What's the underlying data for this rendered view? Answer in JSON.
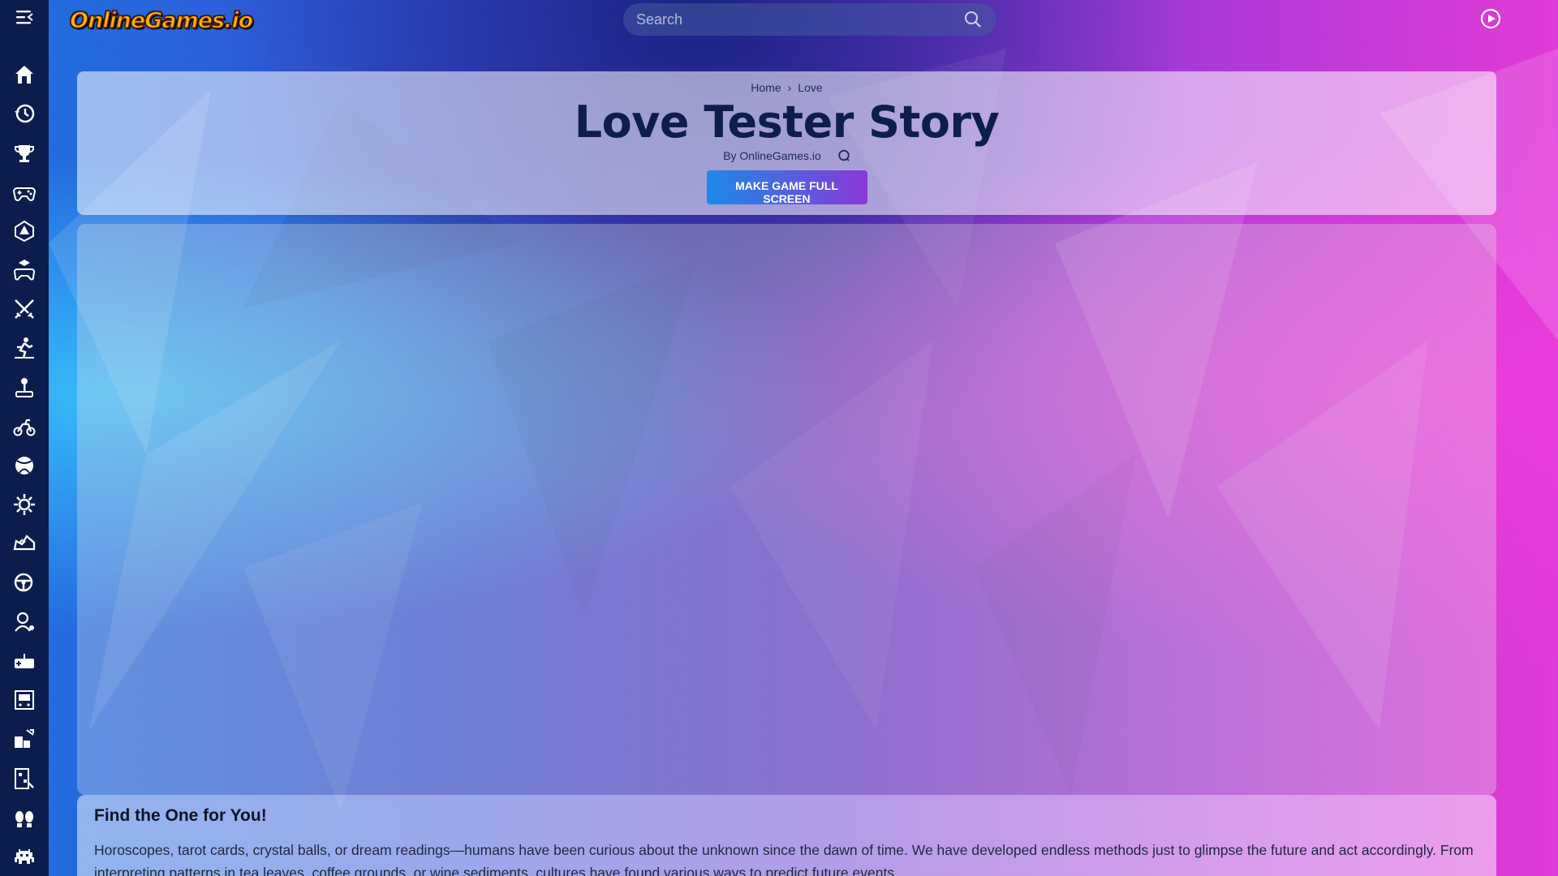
{
  "site": {
    "logo_text": "OnlineGames.io"
  },
  "search": {
    "placeholder": "Search"
  },
  "sidebar": {
    "items": [
      {
        "icon": "home-icon"
      },
      {
        "icon": "history-icon"
      },
      {
        "icon": "trophy-icon"
      },
      {
        "icon": "gamepad-icon"
      },
      {
        "icon": "dice-icon"
      },
      {
        "icon": "controller-cube-icon"
      },
      {
        "icon": "swords-icon"
      },
      {
        "icon": "runner-icon"
      },
      {
        "icon": "joystick-icon"
      },
      {
        "icon": "motorbike-icon"
      },
      {
        "icon": "ball-icon"
      },
      {
        "icon": "gear-icon"
      },
      {
        "icon": "shoe-icon"
      },
      {
        "icon": "steering-wheel-icon"
      },
      {
        "icon": "character-icon"
      },
      {
        "icon": "retro-controller-icon"
      },
      {
        "icon": "arcade-icon"
      },
      {
        "icon": "blocks-icon"
      },
      {
        "icon": "puzzle-icon"
      },
      {
        "icon": "footprints-icon"
      },
      {
        "icon": "alien-icon"
      }
    ]
  },
  "breadcrumb": {
    "home": "Home",
    "separator": "›",
    "current": "Love"
  },
  "game": {
    "title": "Love Tester Story",
    "byline": "By OnlineGames.io",
    "fullscreen_label": "MAKE GAME FULL SCREEN"
  },
  "description": {
    "heading": "Find the One for You!",
    "text": "Horoscopes, tarot cards, crystal balls, or dream readings—humans have been curious about the unknown since the dawn of time. We have developed endless methods just to glimpse the future and act accordingly. From interpreting patterns in tea leaves, coffee grounds, or wine sediments, cultures have found various ways to predict future events."
  },
  "colors": {
    "sidebar_bg": "#0c1d4d",
    "title_color": "#0d1e4a",
    "button_gradient_start": "#1b8ae8",
    "button_gradient_end": "#8a38d8"
  }
}
